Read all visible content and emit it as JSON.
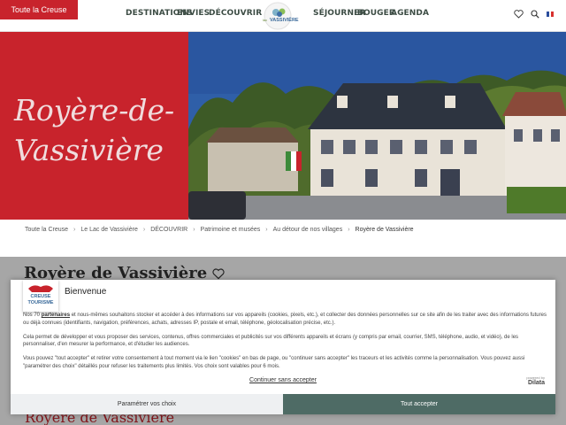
{
  "header": {
    "brand_button": "Toute la Creuse",
    "nav_left": [
      "DESTINATIONS",
      "ENVIES",
      "DÉCOUVRIR"
    ],
    "nav_right": [
      "SÉJOURNER",
      "BOUGER",
      "AGENDA"
    ],
    "logo_text": "VASSIVIÈRE",
    "logo_prefix": "lac",
    "icons": [
      "heart-icon",
      "search-icon",
      "flag-icon"
    ]
  },
  "hero": {
    "title_line1": "Royère-de-",
    "title_line2": "Vassivière"
  },
  "breadcrumb": [
    "Toute la Creuse",
    "Le Lac de Vassivière",
    "DÉCOUVRIR",
    "Patrimoine et musées",
    "Au détour de nos villages",
    "Royère de Vassivière"
  ],
  "page": {
    "title": "Royère de Vassivière",
    "subtitle": "Royère de Vassivière"
  },
  "cookie": {
    "logo_line1": "CREUSE",
    "logo_line2": "TOURISME",
    "title": "Bienvenue",
    "p1_before": "Nos 70 ",
    "p1_link": "partenaires",
    "p1_after": " et nous-mêmes souhaitons stocker et accéder à des informations sur vos appareils (cookies, pixels, etc.), et collecter des données personnelles sur ce site afin de les traiter avec des informations futures ou déjà connues (identifiants, navigation, préférences, achats, adresses IP, postale et email, téléphone, géolocalisation précise, etc.).",
    "p2": "Cela permet de développer et vous proposer des services, contenus, offres commerciales et publicités sur vos différents appareils et écrans (y compris par email, courrier, SMS, téléphone, audio, et vidéo), de les personnaliser, d'en mesurer la performance, et d'étudier les audiences.",
    "p3": "Vous pouvez \"tout accepter\" et retirer votre consentement à tout moment via le lien \"cookies\" en bas de page, ou \"continuer sans accepter\" les traceurs et les activités comme la personnalisation. Vous pouvez aussi \"paramétrer des choix\" détaillés pour refuser les traitements plus limités. Vos choix sont valables pour 6 mois.",
    "continue_link": "Continuer sans accepter",
    "powered_label": "powered by",
    "powered_brand": "Dilata",
    "button_choices": "Paramétrer vos choix",
    "button_accept": "Tout accepter"
  },
  "colors": {
    "brand_red": "#c8232c",
    "accept_green": "#4e6b65",
    "nav_text": "#3c4c44"
  }
}
